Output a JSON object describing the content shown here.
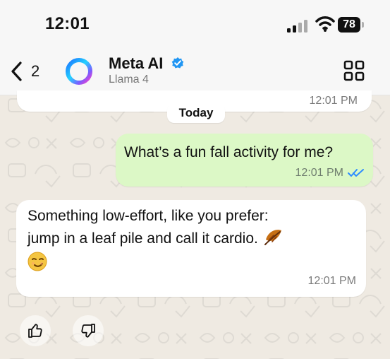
{
  "status_bar": {
    "time": "12:01",
    "battery": "78",
    "battery_level": 78
  },
  "header": {
    "back_count": "2",
    "contact_name": "Meta AI",
    "contact_subtitle": "Llama 4",
    "back_icon": "chevron-left-icon",
    "verified_icon": "verified-badge-icon",
    "apps_icon": "grid-icon"
  },
  "chat": {
    "top_time": "12:01 PM",
    "date_chip": "Today",
    "messages": [
      {
        "direction": "outgoing",
        "text": "What’s a fun fall activity for me?",
        "time": "12:01 PM",
        "status_icon": "double-check-icon"
      },
      {
        "direction": "incoming",
        "lines": [
          "Something low-effort, like you prefer:",
          "jump in a leaf pile and call it cardio."
        ],
        "emoji": [
          "fallen-leaf-icon",
          "smirk-face-icon"
        ],
        "time": "12:01 PM"
      }
    ]
  },
  "reactions": [
    "thumbs-up-icon",
    "thumbs-down-icon"
  ],
  "colors": {
    "background": "#efeae2",
    "outgoing_bubble": "#dcf8c6",
    "incoming_bubble": "#ffffff",
    "accent_blue": "#2196f3"
  }
}
